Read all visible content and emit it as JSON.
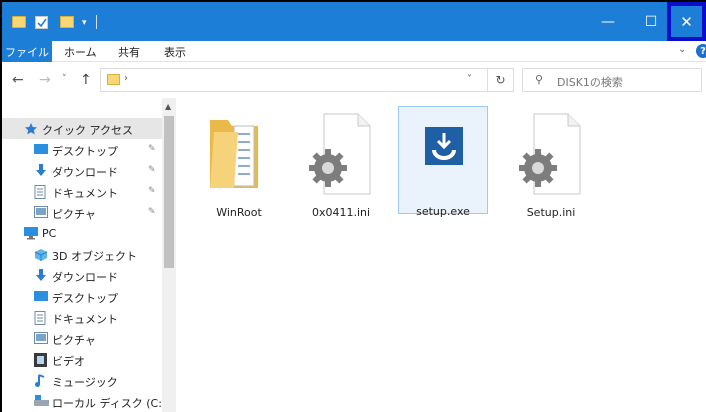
{
  "ribbon": {
    "file": "ファイル",
    "home": "ホーム",
    "share": "共有",
    "view": "表示"
  },
  "titlebar": {
    "minimize": "—",
    "maximize": "☐",
    "close": "✕"
  },
  "address": {
    "crumb_arrow": "›"
  },
  "search": {
    "placeholder": "DISK1の検索"
  },
  "navpane": {
    "items": [
      {
        "label": "クイック アクセス",
        "icon": "star-icon"
      },
      {
        "label": "デスクトップ",
        "icon": "desktop-icon",
        "pinned": true
      },
      {
        "label": "ダウンロード",
        "icon": "download-icon",
        "pinned": true
      },
      {
        "label": "ドキュメント",
        "icon": "document-icon",
        "pinned": true
      },
      {
        "label": "ピクチャ",
        "icon": "pictures-icon",
        "pinned": true
      },
      {
        "label": "PC",
        "icon": "pc-icon"
      },
      {
        "label": "3D オブジェクト",
        "icon": "3d-objects-icon"
      },
      {
        "label": "ダウンロード",
        "icon": "download-icon"
      },
      {
        "label": "デスクトップ",
        "icon": "desktop-icon"
      },
      {
        "label": "ドキュメント",
        "icon": "document-icon"
      },
      {
        "label": "ピクチャ",
        "icon": "pictures-icon"
      },
      {
        "label": "ビデオ",
        "icon": "video-icon"
      },
      {
        "label": "ミュージック",
        "icon": "music-icon"
      },
      {
        "label": "ローカル ディスク (C:)",
        "icon": "drive-icon"
      }
    ]
  },
  "files": [
    {
      "name": "WinRoot",
      "icon": "folder-icon",
      "selected": false
    },
    {
      "name": "0x0411.ini",
      "icon": "settings-file-icon",
      "selected": false
    },
    {
      "name": "setup.exe",
      "icon": "installer-icon",
      "selected": true
    },
    {
      "name": "Setup.ini",
      "icon": "settings-file-icon",
      "selected": false
    }
  ],
  "colors": {
    "accent": "#1c7ed6",
    "highlight_box": "#0a0dcc"
  }
}
